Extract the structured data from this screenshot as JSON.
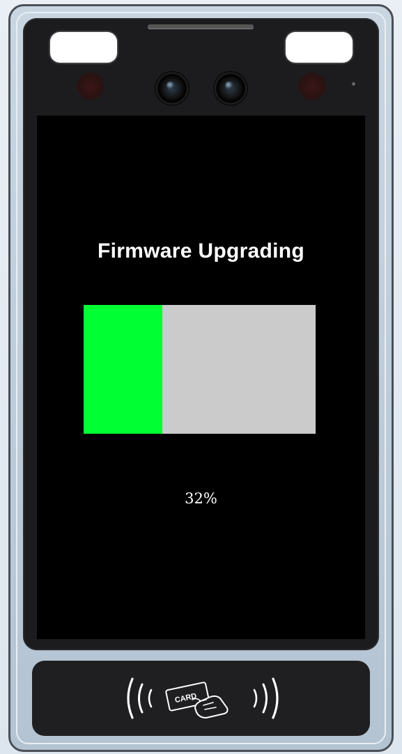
{
  "screen": {
    "title": "Firmware Upgrading",
    "progress_fraction": 0.34,
    "progress_text": "32%",
    "fill_color": "#00ff33",
    "track_color": "#cbcbcb"
  },
  "device": {
    "card_icon_text": "CARD",
    "icons": [
      "camera-icon",
      "fill-light-icon",
      "ir-sensor-icon",
      "nfc-card-icon"
    ]
  }
}
